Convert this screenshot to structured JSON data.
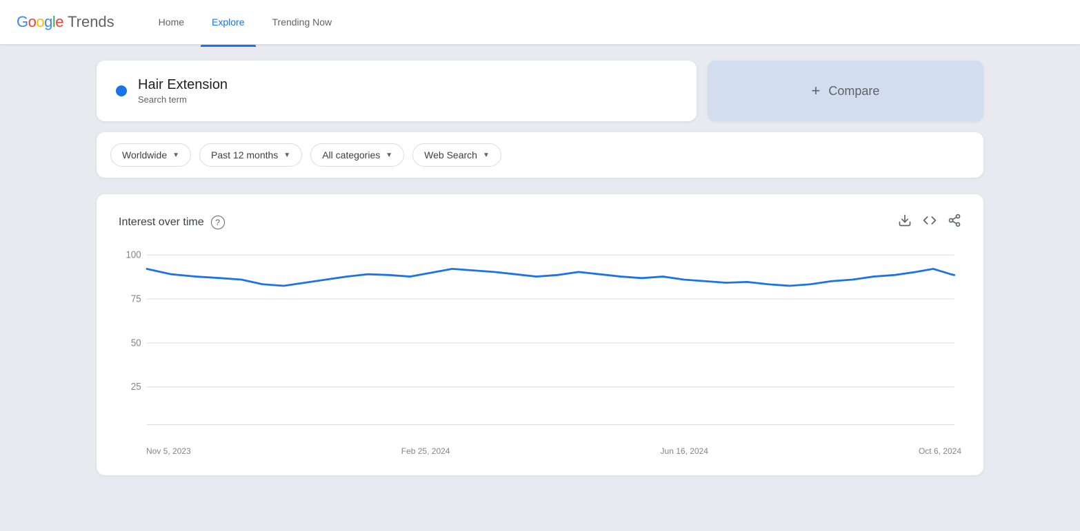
{
  "header": {
    "logo_google": "Google",
    "logo_trends": "Trends",
    "nav": [
      {
        "id": "home",
        "label": "Home",
        "active": false
      },
      {
        "id": "explore",
        "label": "Explore",
        "active": true
      },
      {
        "id": "trending",
        "label": "Trending Now",
        "active": false
      }
    ]
  },
  "search_card": {
    "dot_color": "#1a73e8",
    "term": "Hair Extension",
    "term_type": "Search term",
    "compare_label": "Compare",
    "compare_plus": "+"
  },
  "filters": [
    {
      "id": "location",
      "label": "Worldwide"
    },
    {
      "id": "time",
      "label": "Past 12 months"
    },
    {
      "id": "category",
      "label": "All categories"
    },
    {
      "id": "search_type",
      "label": "Web Search"
    }
  ],
  "chart": {
    "title": "Interest over time",
    "help_icon": "?",
    "y_labels": [
      "100",
      "75",
      "50",
      "25"
    ],
    "x_labels": [
      "Nov 5, 2023",
      "Feb 25, 2024",
      "Jun 16, 2024",
      "Oct 6, 2024"
    ],
    "actions": {
      "download": "↓",
      "embed": "<>",
      "share": "share"
    }
  }
}
